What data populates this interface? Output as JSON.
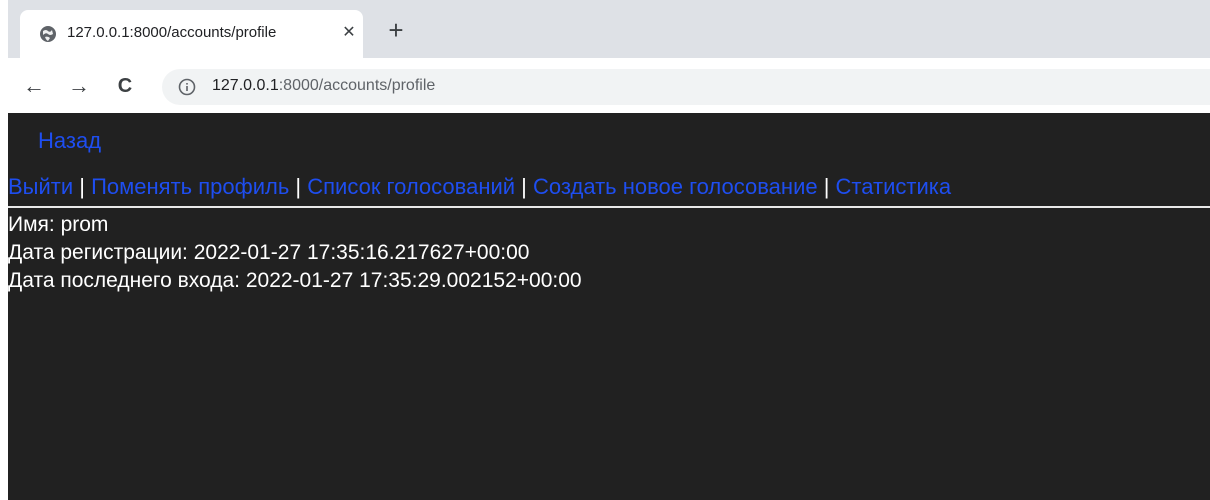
{
  "browser": {
    "tab": {
      "favicon": "globe-icon",
      "title": "127.0.0.1:8000/accounts/profile",
      "close_glyph": "✕"
    },
    "new_tab_glyph": "+",
    "toolbar": {
      "back_glyph": "←",
      "forward_glyph": "→",
      "reload_glyph": "C"
    },
    "address": {
      "icon": "info-icon",
      "host": "127.0.0.1",
      "rest": ":8000/accounts/profile"
    }
  },
  "page": {
    "back_link": "Назад",
    "menu": [
      {
        "label": "Выйти"
      },
      {
        "label": "Поменять профиль"
      },
      {
        "label": "Список голосований"
      },
      {
        "label": "Создать новое голосование"
      },
      {
        "label": "Статистика"
      }
    ],
    "separator": " | ",
    "profile": {
      "name_label": "Имя: ",
      "name_value": "prom",
      "registered_label": "Дата регистрации: ",
      "registered_value": "2022-01-27 17:35:16.217627+00:00",
      "last_login_label": "Дата последнего входа: ",
      "last_login_value": "2022-01-27 17:35:29.002152+00:00"
    }
  },
  "colors": {
    "link": "#1e4ef0",
    "page_bg": "#212121",
    "chrome_bg": "#dee1e6"
  }
}
